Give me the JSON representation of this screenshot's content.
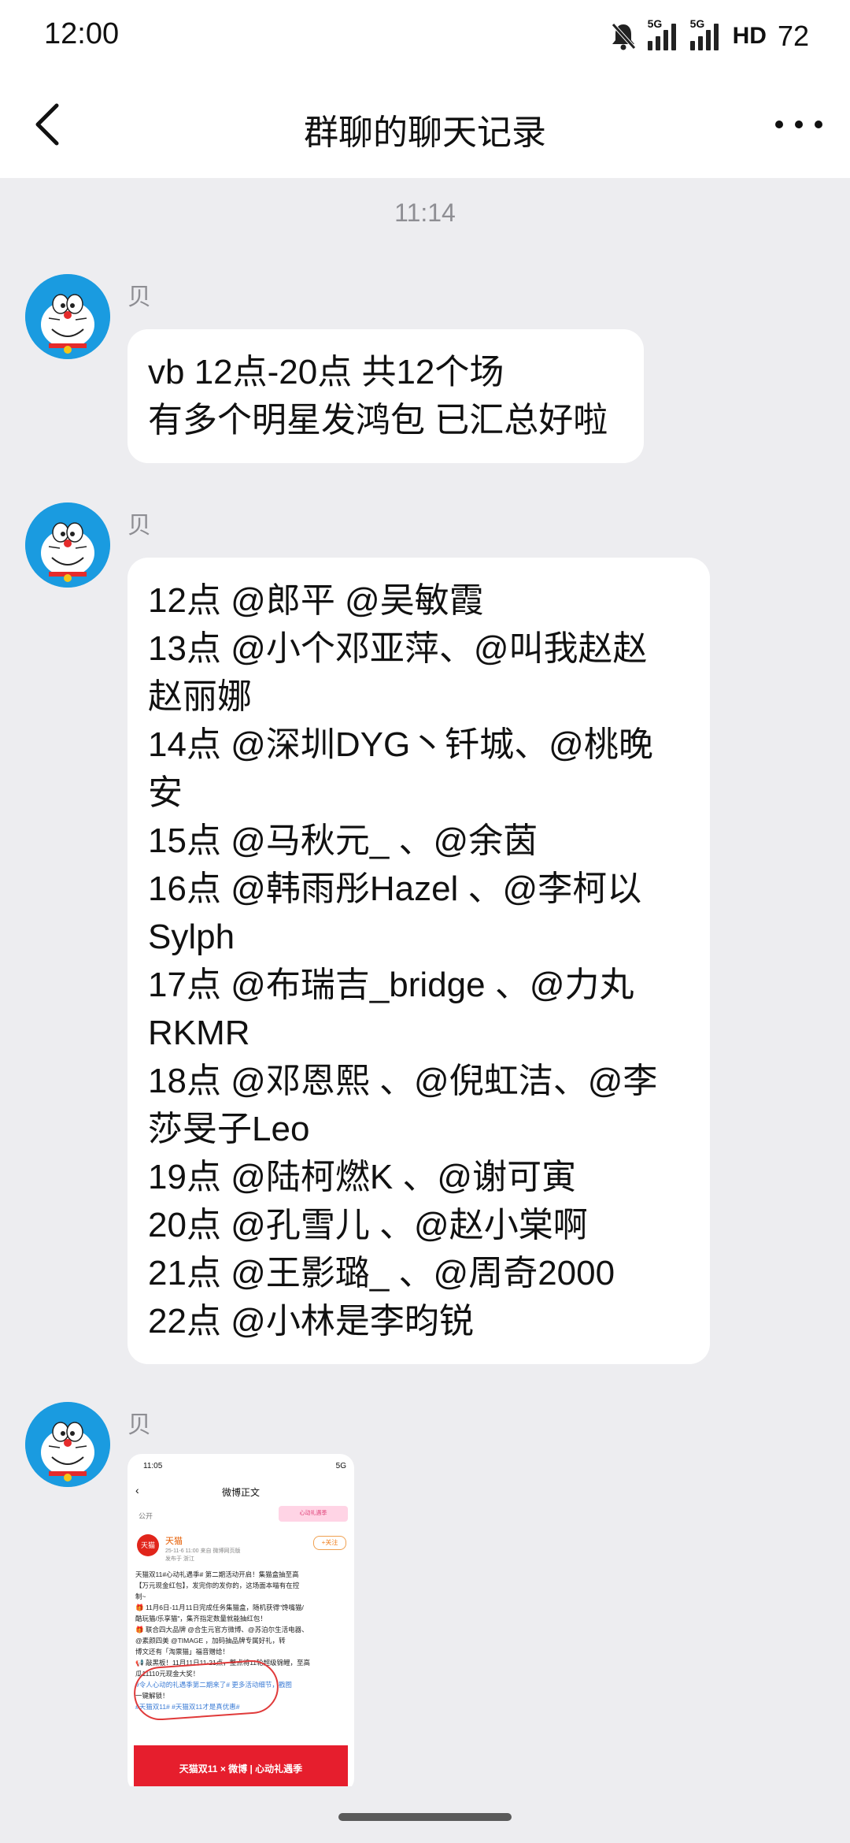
{
  "status_bar": {
    "time": "12:00",
    "network_1": "5G",
    "network_2": "5G",
    "hd": "HD",
    "battery": "72"
  },
  "header": {
    "title": "群聊的聊天记录",
    "back_icon": "chevron-left-icon",
    "more_icon": "more-horizontal-icon"
  },
  "timestamp": "11:14",
  "messages": [
    {
      "sender": "贝",
      "lines": [
        "vb 12点-20点 共12个场",
        "有多个明星发鸿包 已汇总好啦"
      ]
    },
    {
      "sender": "贝",
      "lines": [
        "12点 @郎平 @吴敏霞",
        "13点 @小个邓亚萍、@叫我赵赵",
        "赵丽娜",
        "14点 @深圳DYG丶钎城、@桃晚",
        "安",
        "15点 @马秋元_ 、@余茵",
        "16点 @韩雨彤Hazel 、@李柯以",
        "Sylph",
        "17点 @布瑞吉_bridge 、@力丸",
        "RKMR",
        "18点 @邓恩熙 、@倪虹洁、@李",
        "莎旻子Leo",
        "19点 @陆柯燃K 、@谢可寅",
        "20点 @孔雪儿 、@赵小棠啊",
        "21点 @王影璐_ 、@周奇2000",
        "22点 @小林是李昀锐"
      ]
    },
    {
      "sender": "贝",
      "image": {
        "status_time": "11:05",
        "status_right": "5G",
        "nav_title": "微博正文",
        "public_label": "公开",
        "banner": "心动礼遇季",
        "account_logo": "天猫",
        "account_name": "天猫",
        "meta": "25-11-6 11:00 来自 微博网页版",
        "meta2": "发布于 浙江",
        "follow": "+关注",
        "body": [
          "天猫双11#心动礼遇季# 第二期活动开启！集猫盒抽至高",
          "【万元现金红包】，发完你的发你的，这场面本喵有在控",
          "制~",
          "🎁 11月6日-11月11日完成任务集猫盒，随机获得\"馋嘴猫/",
          "酷玩猫/乐享猫\"，集齐指定数量就能抽红包！",
          "🎁 联合四大品牌 @合生元官方微博、@苏泊尔生活电器、",
          "@素颜四美 @TIMAGE ，加码抽品牌专属好礼，转",
          "博文还有「淘票猫」福音赠给！",
          "📢 敲黑板！11月11日11-21点，整点将11轮超级锦鲤，至高",
          "瓜11110元现金大奖！",
          "#令人心动的礼遇季第二期来了# 更多活动细节，戳图",
          "一键解锁！",
          "#天猫双11# #天猫双11才是真优惠#"
        ],
        "footer": "天猫双11 × 微博 | 心动礼遇季"
      }
    }
  ],
  "colors": {
    "background": "#ededf0",
    "bubble": "#ffffff",
    "avatar": "#1a9be0",
    "meta_text": "#8e8e93"
  }
}
